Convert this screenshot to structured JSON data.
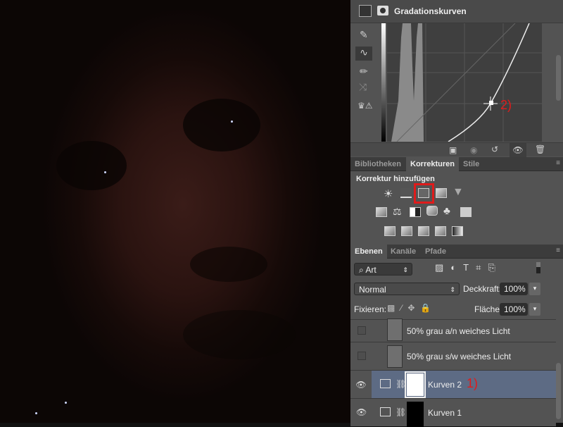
{
  "properties": {
    "title": "Gradationskurven",
    "annotation": "2)",
    "annotation_color": "#e01b1b"
  },
  "adjustments": {
    "tabs": [
      "Bibliotheken",
      "Korrekturen",
      "Stile"
    ],
    "active_tab": "Korrekturen",
    "add_label": "Korrektur hinzufügen",
    "highlight_color": "#e01b1b",
    "icons_row1": [
      "brightness-icon",
      "levels-icon",
      "curves-icon",
      "exposure-icon",
      "vibrance-icon"
    ],
    "icons_row2": [
      "hue-saturation-icon",
      "color-balance-icon",
      "black-white-icon",
      "photo-filter-icon",
      "channel-mixer-icon",
      "color-lookup-icon"
    ],
    "icons_row3": [
      "invert-icon",
      "posterize-icon",
      "threshold-icon",
      "selective-color-icon",
      "gradient-map-icon"
    ]
  },
  "layers": {
    "tabs": [
      "Ebenen",
      "Kanäle",
      "Pfade"
    ],
    "active_tab": "Ebenen",
    "filter": "Art",
    "blend_mode": "Normal",
    "opacity_label": "Deckkraft:",
    "opacity": "100%",
    "lock_label": "Fixieren:",
    "fill_label": "Fläche:",
    "fill": "100%",
    "items": [
      {
        "name": "50% grau a/n weiches Licht",
        "visible": false
      },
      {
        "name": "50% grau s/w weiches Licht",
        "visible": false
      },
      {
        "name": "Kurven 2",
        "visible": true,
        "selected": true,
        "annotation": "1)"
      },
      {
        "name": "Kurven 1",
        "visible": true
      }
    ]
  }
}
